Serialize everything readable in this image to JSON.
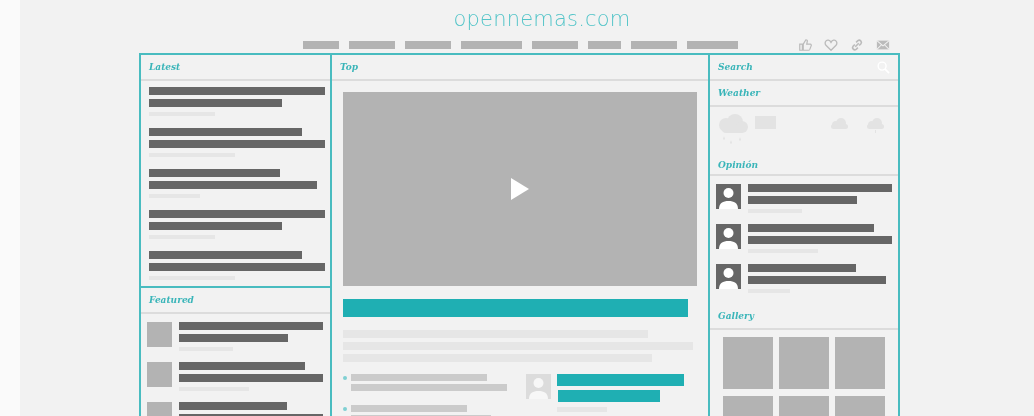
{
  "logo": "opennemas.com",
  "columns": [
    {
      "sections": [
        {
          "kind": "list",
          "title": "Latest"
        },
        {
          "kind": "featured",
          "title": "Featured"
        }
      ]
    },
    {
      "sections": [
        {
          "kind": "video",
          "title": "Top"
        }
      ]
    },
    {
      "sections": [
        {
          "kind": "search",
          "title": "Search"
        },
        {
          "kind": "weather",
          "title": "Weather"
        },
        {
          "kind": "opinion",
          "title": "Opinión"
        },
        {
          "kind": "gallery",
          "title": "Gallery"
        }
      ]
    }
  ]
}
